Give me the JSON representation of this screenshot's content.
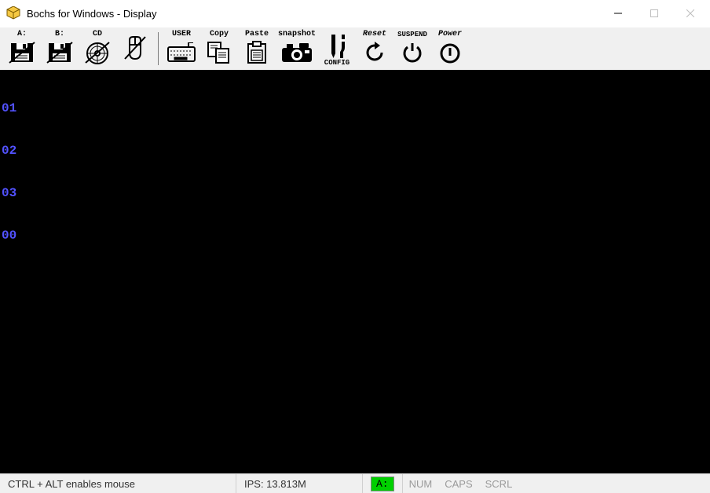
{
  "window": {
    "title": "Bochs for Windows - Display"
  },
  "toolbar": {
    "items": [
      {
        "label": "A:"
      },
      {
        "label": "B:"
      },
      {
        "label": "CD"
      },
      {
        "label": ""
      },
      {
        "label": "USER"
      },
      {
        "label": "Copy"
      },
      {
        "label": "Paste"
      },
      {
        "label": "snapshot"
      },
      {
        "label_top": "",
        "label_bottom": "CONFIG"
      },
      {
        "label": "Reset"
      },
      {
        "label": "SUSPEND"
      },
      {
        "label": "Power"
      }
    ]
  },
  "console": {
    "lines": [
      "01",
      "02",
      "03",
      "00"
    ]
  },
  "statusbar": {
    "hint": "CTRL + ALT enables mouse",
    "ips": "IPS: 13.813M",
    "drive": "A:",
    "num": "NUM",
    "caps": "CAPS",
    "scrl": "SCRL"
  }
}
